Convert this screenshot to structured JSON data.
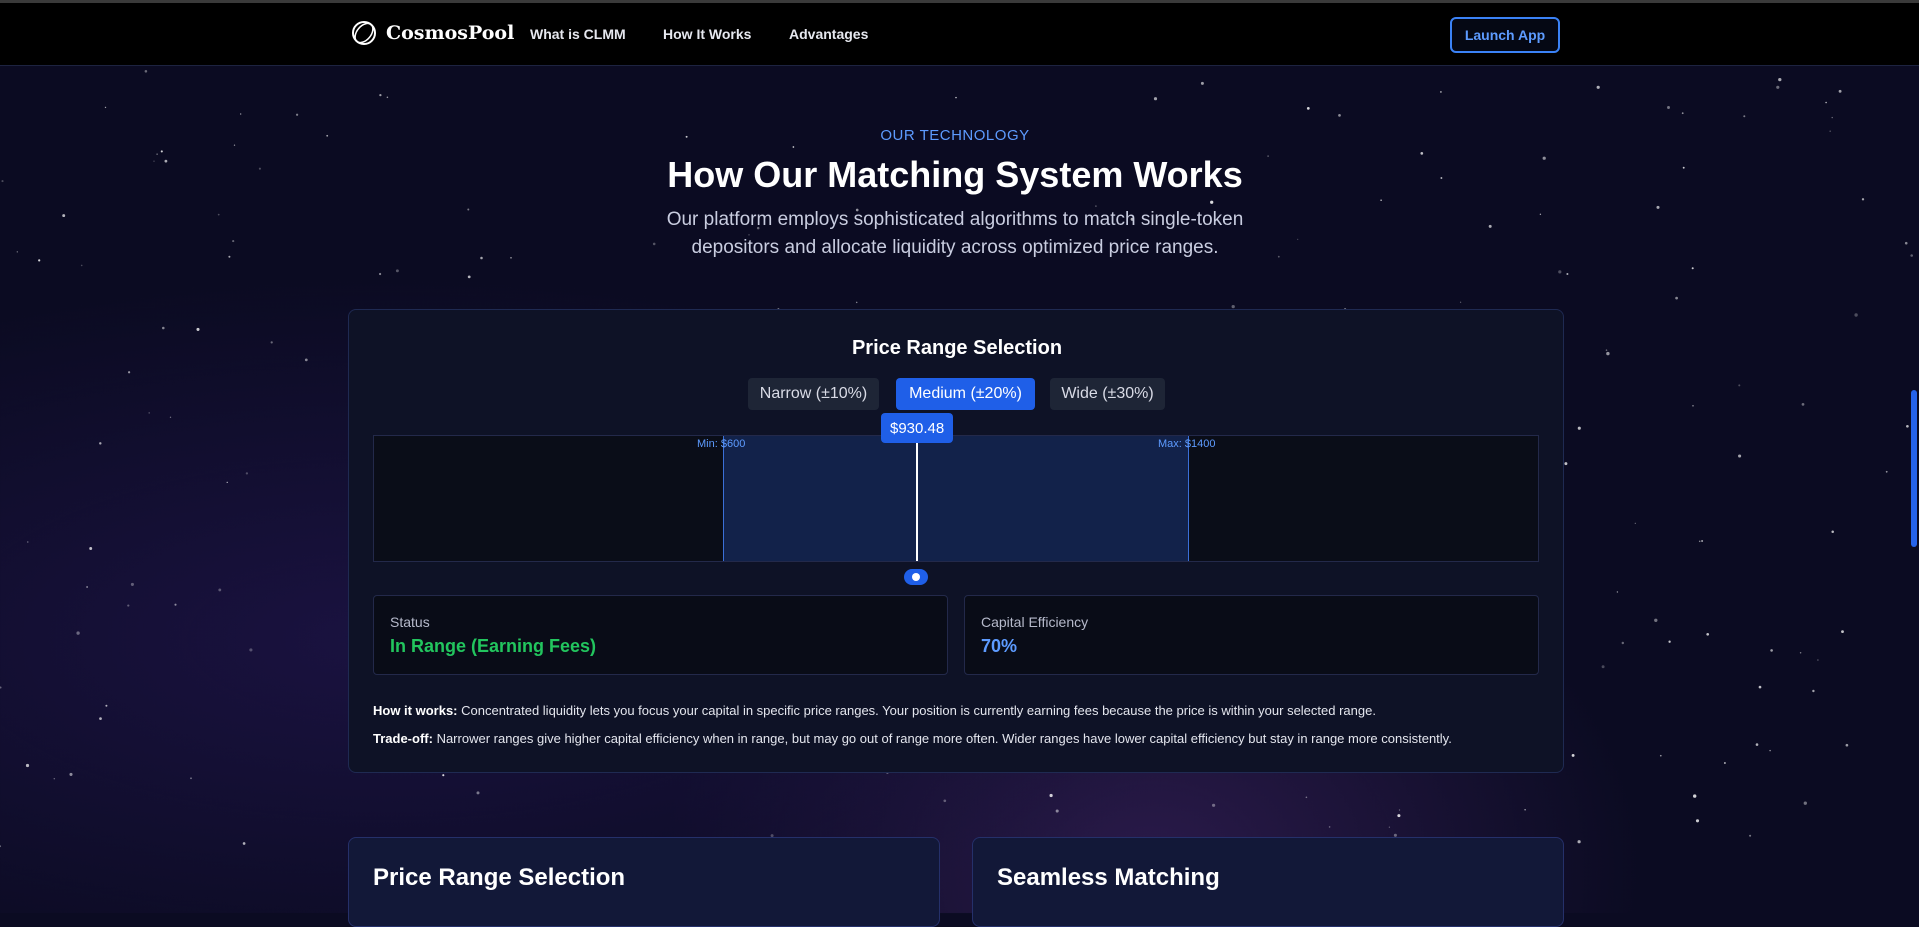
{
  "nav": {
    "brand": "CosmosPool",
    "links": [
      "What is CLMM",
      "How It Works",
      "Advantages"
    ],
    "launch_label": "Launch App"
  },
  "header": {
    "eyebrow": "OUR TECHNOLOGY",
    "title": "How Our Matching System Works",
    "lead": "Our platform employs sophisticated algorithms to match single-token depositors and allocate liquidity across optimized price ranges."
  },
  "range_card": {
    "title": "Price Range Selection",
    "options": [
      {
        "label": "Narrow (±10%)",
        "active": false
      },
      {
        "label": "Medium (±20%)",
        "active": true
      },
      {
        "label": "Wide (±30%)",
        "active": false
      }
    ],
    "min_label": "Min: $600",
    "max_label": "Max: $1400",
    "current_price_label": "$930.48",
    "current_price": 930.48,
    "range_min": 600,
    "range_max": 1400,
    "status": {
      "label": "Status",
      "value": "In Range (Earning Fees)",
      "color": "#22c55e"
    },
    "efficiency": {
      "label": "Capital Efficiency",
      "value": "70%",
      "color": "#5d9bff"
    },
    "notes": [
      {
        "lead": "How it works:",
        "text": " Concentrated liquidity lets you focus your capital in specific price ranges. Your position is currently earning fees because the price is within your selected range."
      },
      {
        "lead": "Trade-off:",
        "text": " Narrower ranges give higher capital efficiency when in range, but may go out of range more often. Wider ranges have lower capital efficiency but stay in range more consistently."
      }
    ]
  },
  "features": [
    {
      "title": "Price Range Selection"
    },
    {
      "title": "Seamless Matching"
    }
  ],
  "colors": {
    "accent": "#1f5fe8",
    "link": "#5d9bff",
    "background": "#0b0b22",
    "success": "#22c55e"
  }
}
